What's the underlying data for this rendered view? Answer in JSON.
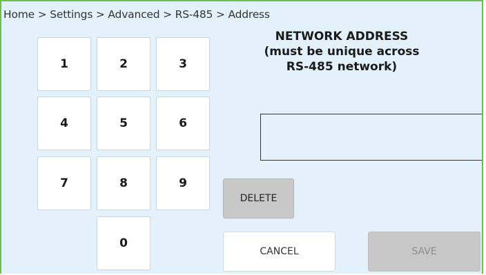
{
  "breadcrumb": "Home > Settings > Advanced > RS-485 > Address",
  "title": {
    "line1": "NETWORK ADDRESS",
    "line2": "(must be unique across",
    "line3": "RS-485 network)"
  },
  "keypad": {
    "k1": "1",
    "k2": "2",
    "k3": "3",
    "k4": "4",
    "k5": "5",
    "k6": "6",
    "k7": "7",
    "k8": "8",
    "k9": "9",
    "k0": "0"
  },
  "address_field": {
    "value": "",
    "placeholder": ""
  },
  "buttons": {
    "delete": "DELETE",
    "cancel": "CANCEL",
    "save": "SAVE"
  },
  "colors": {
    "background": "#e3f1fb",
    "border_accent": "#6dbf4b",
    "disabled_button": "#c8c8c8"
  }
}
